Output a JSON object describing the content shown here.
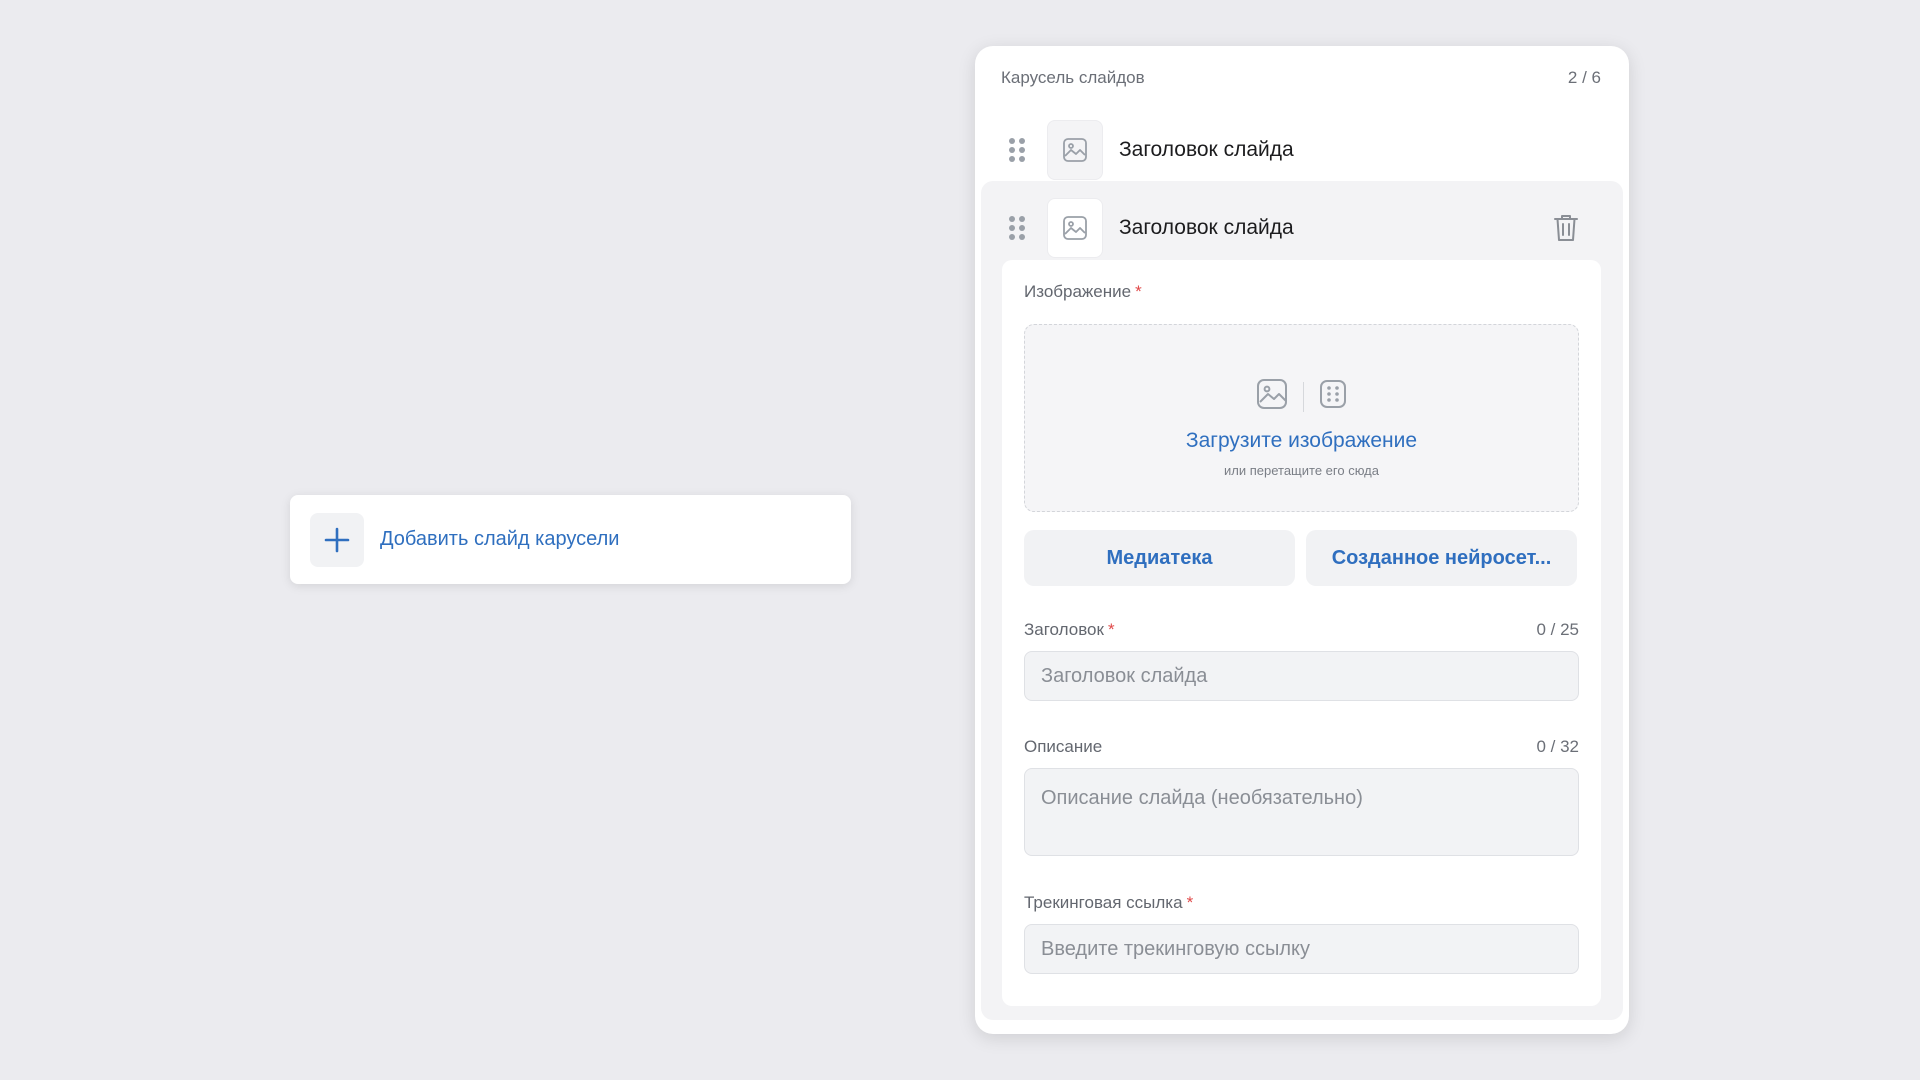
{
  "add_card": {
    "label": "Добавить слайд карусели",
    "icon": "plus-icon"
  },
  "panel": {
    "title": "Карусель слайдов",
    "counter": "2 / 6",
    "slides": [
      {
        "title": "Заголовок слайда",
        "icon": "image-icon"
      },
      {
        "title": "Заголовок слайда",
        "icon": "image-icon",
        "expanded": true
      }
    ]
  },
  "form": {
    "image": {
      "label": "Изображение",
      "required": "*",
      "upload_title": "Загрузите изображение",
      "upload_subtitle": "или перетащите его сюда"
    },
    "buttons": {
      "media": "Медиатека",
      "ai": "Созданное нейросет..."
    },
    "title": {
      "label": "Заголовок",
      "required": "*",
      "counter": "0 / 25",
      "placeholder": "Заголовок слайда"
    },
    "description": {
      "label": "Описание",
      "counter": "0 / 32",
      "placeholder": "Описание слайда (необязательно)"
    },
    "tracking": {
      "label": "Трекинговая ссылка",
      "required": "*",
      "placeholder": "Введите трекинговую ссылку"
    }
  },
  "colors": {
    "accent": "#2f6fbf",
    "required": "#e04848",
    "background": "#ebebef"
  }
}
